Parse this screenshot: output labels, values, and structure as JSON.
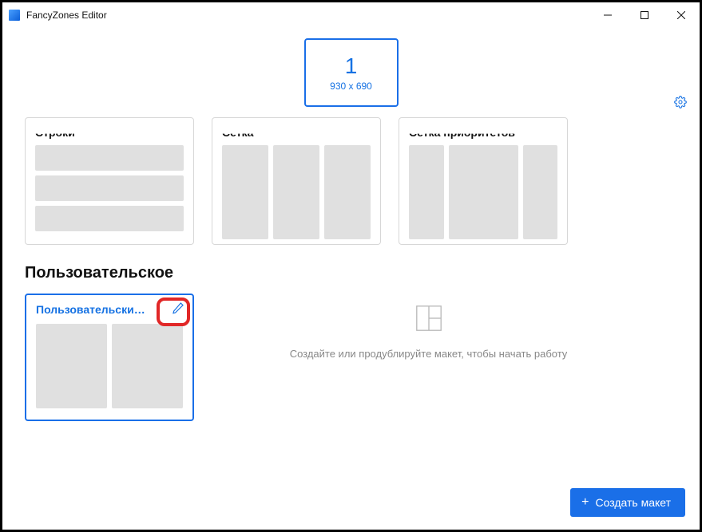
{
  "window": {
    "title": "FancyZones Editor"
  },
  "monitor": {
    "index": "1",
    "dims": "930 x 690"
  },
  "templates": [
    {
      "title": "Строки"
    },
    {
      "title": "Сетка"
    },
    {
      "title": "Сетка приоритетов"
    }
  ],
  "custom_section_title": "Пользовательское",
  "custom_layout": {
    "title": "Пользовательский..."
  },
  "empty_hint": "Создайте или продублируйте макет, чтобы начать работу",
  "create_button": "Создать макет"
}
